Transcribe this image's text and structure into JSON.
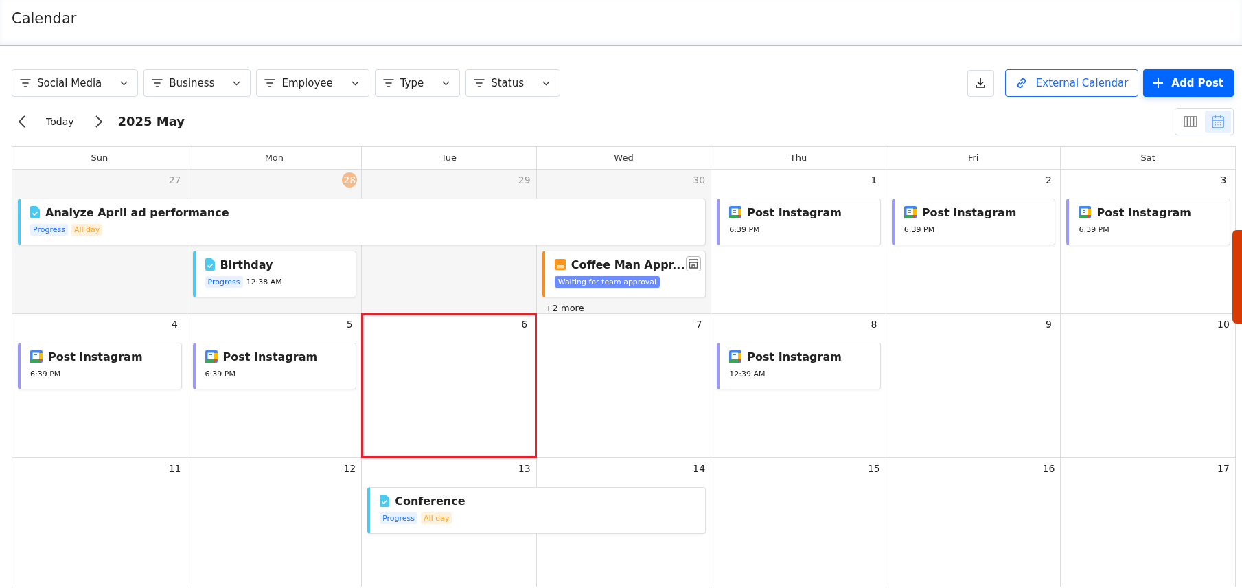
{
  "page": {
    "title": "Calendar"
  },
  "filters": [
    {
      "label": "Social Media"
    },
    {
      "label": "Business"
    },
    {
      "label": "Employee"
    },
    {
      "label": "Type"
    },
    {
      "label": "Status"
    }
  ],
  "actions": {
    "external_calendar": "External Calendar",
    "add_post": "Add Post"
  },
  "navigation": {
    "today": "Today",
    "period": "2025 May"
  },
  "view_toggle": [
    {
      "kind": "columns",
      "selected": false
    },
    {
      "kind": "month",
      "selected": true
    }
  ],
  "weekdays": [
    "Sun",
    "Mon",
    "Tue",
    "Wed",
    "Thu",
    "Fri",
    "Sat"
  ],
  "weeks": [
    {
      "days": [
        {
          "number": "27",
          "in_month": false,
          "today": false,
          "selected": false,
          "events": [
            {
              "kind": "task",
              "title": "Analyze April ad performance",
              "tags": [
                {
                  "kind": "status",
                  "text": "Progress"
                },
                {
                  "kind": "allday",
                  "text": "All day"
                }
              ]
            }
          ]
        },
        {
          "number": "28",
          "in_month": false,
          "today": true,
          "selected": false,
          "events": [
            {
              "kind": "continuation"
            },
            {
              "kind": "task",
              "title": "Birthday",
              "tags": [
                {
                  "kind": "status",
                  "text": "Progress"
                },
                {
                  "kind": "time",
                  "text": "12:38 AM"
                }
              ]
            }
          ]
        },
        {
          "number": "29",
          "in_month": false,
          "today": false,
          "selected": false,
          "events": [
            {
              "kind": "continuation"
            }
          ]
        },
        {
          "number": "30",
          "in_month": false,
          "today": false,
          "selected": false,
          "events": [
            {
              "kind": "continuation"
            },
            {
              "kind": "approval",
              "title": "Coffee Man Appr...",
              "tags": [
                {
                  "kind": "approval",
                  "text": "Waiting for team approval"
                }
              ]
            }
          ],
          "more": "+2 more"
        },
        {
          "number": "1",
          "in_month": true,
          "today": false,
          "selected": false,
          "events": [
            {
              "kind": "post",
              "title": "Post Instagram",
              "tags": [
                {
                  "kind": "time",
                  "text": "6:39 PM"
                }
              ]
            }
          ]
        },
        {
          "number": "2",
          "in_month": true,
          "today": false,
          "selected": false,
          "events": [
            {
              "kind": "post",
              "title": "Post Instagram",
              "tags": [
                {
                  "kind": "time",
                  "text": "6:39 PM"
                }
              ]
            }
          ]
        },
        {
          "number": "3",
          "in_month": true,
          "today": false,
          "selected": false,
          "events": [
            {
              "kind": "post",
              "title": "Post Instagram",
              "tags": [
                {
                  "kind": "time",
                  "text": "6:39 PM"
                }
              ]
            }
          ]
        }
      ]
    },
    {
      "days": [
        {
          "number": "4",
          "in_month": true,
          "today": false,
          "selected": false,
          "events": [
            {
              "kind": "post",
              "title": "Post Instagram",
              "tags": [
                {
                  "kind": "time",
                  "text": "6:39 PM"
                }
              ]
            }
          ]
        },
        {
          "number": "5",
          "in_month": true,
          "today": false,
          "selected": false,
          "events": [
            {
              "kind": "post",
              "title": "Post Instagram",
              "tags": [
                {
                  "kind": "time",
                  "text": "6:39 PM"
                }
              ]
            }
          ]
        },
        {
          "number": "6",
          "in_month": true,
          "today": false,
          "selected": true
        },
        {
          "number": "7",
          "in_month": true,
          "today": false,
          "selected": false
        },
        {
          "number": "8",
          "in_month": true,
          "today": false,
          "selected": false,
          "events": [
            {
              "kind": "post",
              "title": "Post Instagram",
              "tags": [
                {
                  "kind": "time",
                  "text": "12:39 AM"
                }
              ]
            }
          ]
        },
        {
          "number": "9",
          "in_month": true,
          "today": false,
          "selected": false
        },
        {
          "number": "10",
          "in_month": true,
          "today": false,
          "selected": false
        }
      ]
    },
    {
      "days": [
        {
          "number": "11",
          "in_month": true,
          "today": false,
          "selected": false
        },
        {
          "number": "12",
          "in_month": true,
          "today": false,
          "selected": false
        },
        {
          "number": "13",
          "in_month": true,
          "today": false,
          "selected": false,
          "events": [
            {
              "kind": "task",
              "title": "Conference",
              "tags": [
                {
                  "kind": "status",
                  "text": "Progress"
                },
                {
                  "kind": "allday",
                  "text": "All day"
                }
              ]
            }
          ]
        },
        {
          "number": "14",
          "in_month": true,
          "today": false,
          "selected": false,
          "events": [
            {
              "kind": "continuation"
            }
          ]
        },
        {
          "number": "15",
          "in_month": true,
          "today": false,
          "selected": false
        },
        {
          "number": "16",
          "in_month": true,
          "today": false,
          "selected": false
        },
        {
          "number": "17",
          "in_month": true,
          "today": false,
          "selected": false
        }
      ]
    }
  ]
}
